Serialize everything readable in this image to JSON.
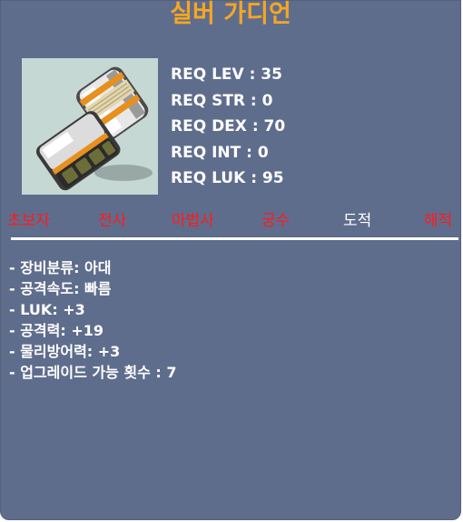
{
  "item": {
    "name": "실버 가디언",
    "image_icon": "silver-guardian-glove-icon",
    "requirements": [
      {
        "text": "REQ LEV : 35"
      },
      {
        "text": "REQ STR : 0"
      },
      {
        "text": "REQ DEX : 70"
      },
      {
        "text": "REQ INT : 0"
      },
      {
        "text": "REQ LUK : 95"
      }
    ],
    "jobs": [
      {
        "label": "초보자",
        "available": false
      },
      {
        "label": "전사",
        "available": false
      },
      {
        "label": "마법사",
        "available": false
      },
      {
        "label": "궁수",
        "available": false
      },
      {
        "label": "도적",
        "available": true
      },
      {
        "label": "해적",
        "available": false
      }
    ],
    "description": [
      "- 장비분류: 아대",
      "- 공격속도: 빠름",
      "- LUK: +3",
      "- 공격력: +19",
      "- 물리방어력: +3",
      "- 업그레이드 가능 횟수 : 7"
    ]
  },
  "colors": {
    "background": "#5f6d8d",
    "title": "#f5a623",
    "text": "#ffffff",
    "job_unavailable": "#ff1a1a",
    "job_available": "#ffffff"
  }
}
